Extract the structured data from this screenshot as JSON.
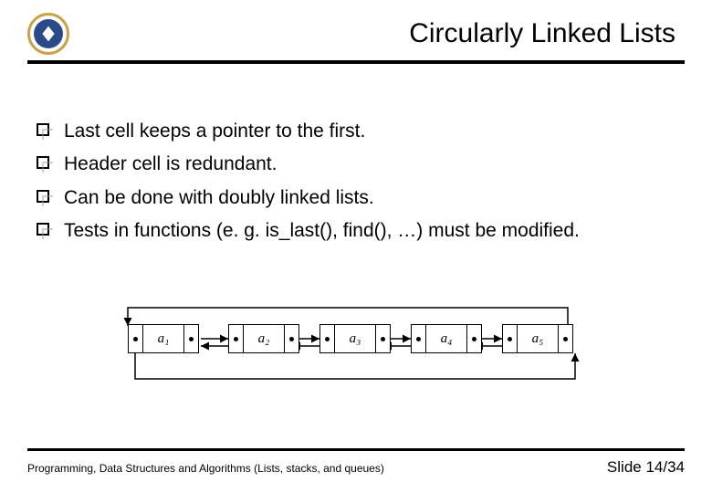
{
  "header": {
    "title": "Circularly Linked Lists",
    "logo_name": "organization-seal-icon"
  },
  "bullets": [
    "Last cell keeps a pointer to the first.",
    "Header cell is redundant.",
    "Can be done with doubly linked lists.",
    "Tests in functions (e. g. is_last(), find(), …) must be modified."
  ],
  "diagram": {
    "nodes": [
      "a₁",
      "a₂",
      "a₃",
      "a₄",
      "a₅"
    ],
    "type": "circular-doubly-linked-list"
  },
  "footer": {
    "left": "Programming, Data Structures and Algorithms  (Lists, stacks, and queues)",
    "right": "Slide 14/34"
  }
}
